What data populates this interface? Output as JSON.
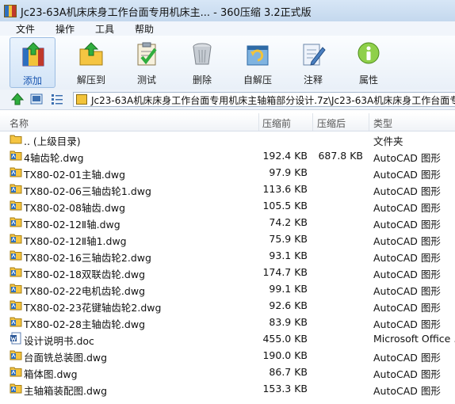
{
  "window": {
    "title": "Jc23-63A机床床身工作台面专用机床主... - 360压缩 3.2正式版"
  },
  "menu": [
    "文件",
    "操作",
    "工具",
    "帮助"
  ],
  "toolbar": [
    {
      "label": "添加",
      "icon": "add-archive-icon"
    },
    {
      "label": "解压到",
      "icon": "extract-to-icon"
    },
    {
      "label": "测试",
      "icon": "test-clipboard-icon"
    },
    {
      "label": "删除",
      "icon": "delete-bin-icon"
    },
    {
      "label": "自解压",
      "icon": "self-extract-icon"
    },
    {
      "label": "注释",
      "icon": "comment-icon"
    },
    {
      "label": "属性",
      "icon": "info-icon"
    }
  ],
  "address": {
    "path": "Jc23-63A机床床身工作台面专用机床主轴箱部分设计.7z\\Jc23-63A机床床身工作台面专"
  },
  "columns": {
    "name": "名称",
    "size": "压缩前",
    "packed": "压缩后",
    "type": "类型"
  },
  "files": [
    {
      "name": ".. (上级目录)",
      "size": "",
      "packed": "",
      "type": "文件夹",
      "icon": "folder"
    },
    {
      "name": "4轴齿轮.dwg",
      "size": "192.4 KB",
      "packed": "687.8 KB",
      "type": "AutoCAD 图形",
      "icon": "dwg"
    },
    {
      "name": "TX80-02-01主轴.dwg",
      "size": "97.9 KB",
      "packed": "",
      "type": "AutoCAD 图形",
      "icon": "dwg"
    },
    {
      "name": "TX80-02-06三轴齿轮1.dwg",
      "size": "113.6 KB",
      "packed": "",
      "type": "AutoCAD 图形",
      "icon": "dwg"
    },
    {
      "name": "TX80-02-08轴齿.dwg",
      "size": "105.5 KB",
      "packed": "",
      "type": "AutoCAD 图形",
      "icon": "dwg"
    },
    {
      "name": "TX80-02-12Ⅱ轴.dwg",
      "size": "74.2 KB",
      "packed": "",
      "type": "AutoCAD 图形",
      "icon": "dwg"
    },
    {
      "name": "TX80-02-12Ⅱ轴1.dwg",
      "size": "75.9 KB",
      "packed": "",
      "type": "AutoCAD 图形",
      "icon": "dwg"
    },
    {
      "name": "TX80-02-16三轴齿轮2.dwg",
      "size": "93.1 KB",
      "packed": "",
      "type": "AutoCAD 图形",
      "icon": "dwg"
    },
    {
      "name": "TX80-02-18双联齿轮.dwg",
      "size": "174.7 KB",
      "packed": "",
      "type": "AutoCAD 图形",
      "icon": "dwg"
    },
    {
      "name": "TX80-02-22电机齿轮.dwg",
      "size": "99.1 KB",
      "packed": "",
      "type": "AutoCAD 图形",
      "icon": "dwg"
    },
    {
      "name": "TX80-02-23花键轴齿轮2.dwg",
      "size": "92.6 KB",
      "packed": "",
      "type": "AutoCAD 图形",
      "icon": "dwg"
    },
    {
      "name": "TX80-02-28主轴齿轮.dwg",
      "size": "83.9 KB",
      "packed": "",
      "type": "AutoCAD 图形",
      "icon": "dwg"
    },
    {
      "name": "设计说明书.doc",
      "size": "455.0 KB",
      "packed": "",
      "type": "Microsoft Office ...",
      "icon": "doc"
    },
    {
      "name": "台面铣总装图.dwg",
      "size": "190.0 KB",
      "packed": "",
      "type": "AutoCAD 图形",
      "icon": "dwg"
    },
    {
      "name": "箱体图.dwg",
      "size": "86.7 KB",
      "packed": "",
      "type": "AutoCAD 图形",
      "icon": "dwg"
    },
    {
      "name": "主轴箱装配图.dwg",
      "size": "153.3 KB",
      "packed": "",
      "type": "AutoCAD 图形",
      "icon": "dwg"
    }
  ]
}
